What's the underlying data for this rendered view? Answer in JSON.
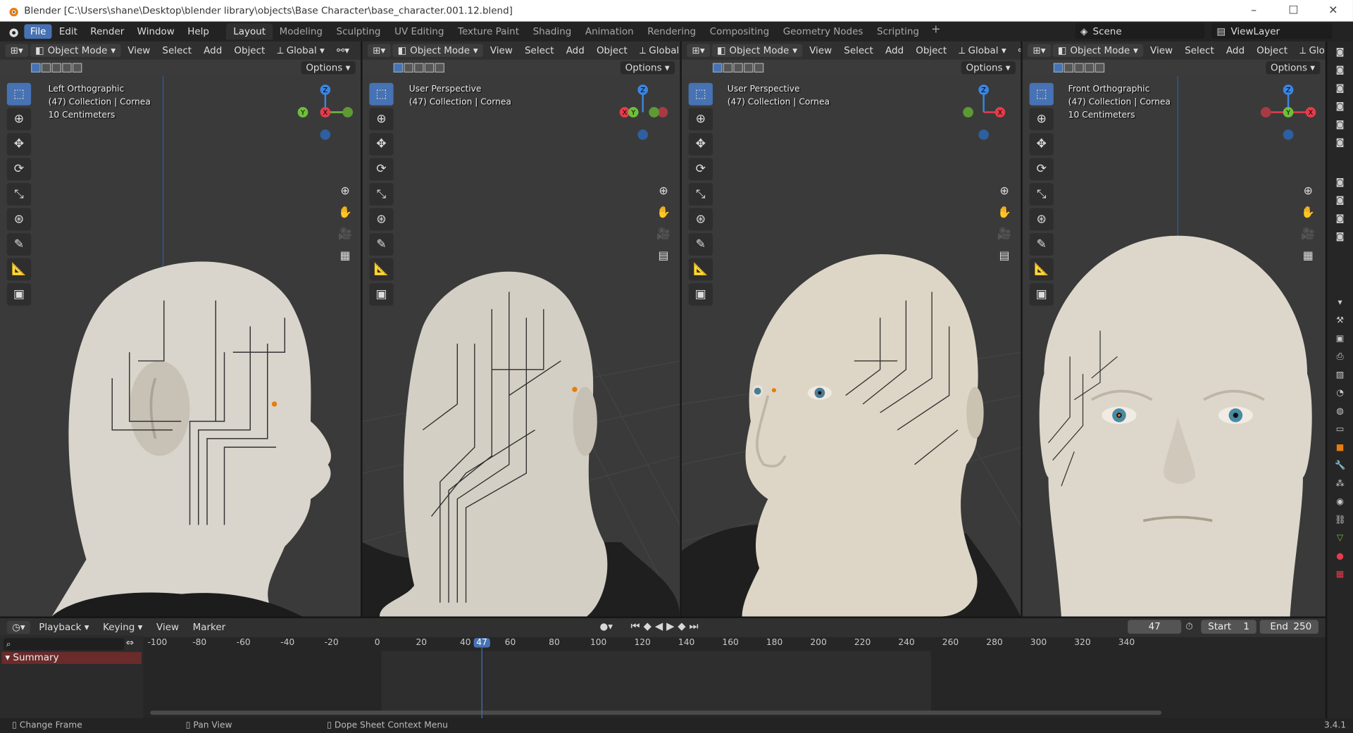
{
  "title": "Blender [C:\\Users\\shane\\Desktop\\blender library\\objects\\Base Character\\base_character.001.12.blend]",
  "window_controls": [
    "–",
    "☐",
    "✕"
  ],
  "menu": [
    "File",
    "Edit",
    "Render",
    "Window",
    "Help"
  ],
  "workspaces": [
    "Layout",
    "Modeling",
    "Sculpting",
    "UV Editing",
    "Texture Paint",
    "Shading",
    "Animation",
    "Rendering",
    "Compositing",
    "Geometry Nodes",
    "Scripting"
  ],
  "workspace_add": "+",
  "scene": "Scene",
  "view_layer": "ViewLayer",
  "viewport_header": {
    "mode": "Object Mode",
    "menus": [
      "View",
      "Select",
      "Add",
      "Object"
    ],
    "orientation": "Global",
    "options": "Options"
  },
  "viewports": [
    {
      "line1": "Left Orthographic",
      "line2": "(47) Collection | Cornea",
      "line3": "10 Centimeters"
    },
    {
      "line1": "User Perspective",
      "line2": "(47) Collection | Cornea",
      "line3": ""
    },
    {
      "line1": "User Perspective",
      "line2": "(47) Collection | Cornea",
      "line3": ""
    },
    {
      "line1": "Front Orthographic",
      "line2": "(47) Collection | Cornea",
      "line3": "10 Centimeters"
    }
  ],
  "gizmo_labels": {
    "x": "X",
    "y": "Y",
    "z": "Z"
  },
  "timeline": {
    "menus": [
      "Playback",
      "Keying",
      "View",
      "Marker"
    ],
    "current_frame": "47",
    "start_label": "Start",
    "start": "1",
    "end_label": "End",
    "end": "250",
    "ticks": [
      "-100",
      "-80",
      "-60",
      "-40",
      "-20",
      "0",
      "20",
      "40",
      "47",
      "60",
      "80",
      "100",
      "120",
      "140",
      "160",
      "180",
      "200",
      "220",
      "240",
      "260",
      "280",
      "300",
      "320",
      "340"
    ],
    "summary": "Summary"
  },
  "status": {
    "left": "Change Frame",
    "middle": "Pan View",
    "right": "Dope Sheet Context Menu",
    "version": "3.4.1"
  },
  "colors": {
    "accent": "#4772b3",
    "x_axis": "#e63b4b",
    "y_axis": "#6fbf3a",
    "z_axis": "#3b85e0"
  }
}
